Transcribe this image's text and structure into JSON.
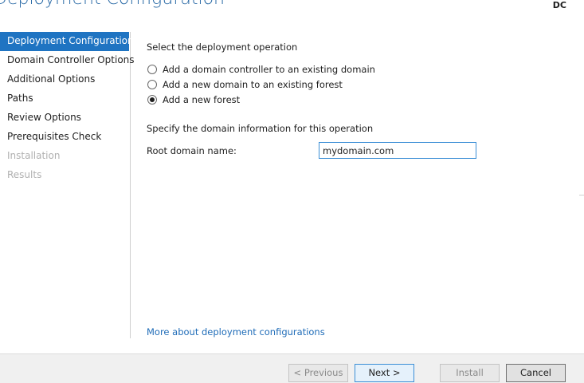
{
  "header": {
    "title": "Deployment Configuration",
    "server": "DC"
  },
  "sidebar": {
    "items": [
      {
        "label": "Deployment Configuration",
        "state": "active"
      },
      {
        "label": "Domain Controller Options",
        "state": "enabled"
      },
      {
        "label": "Additional Options",
        "state": "enabled"
      },
      {
        "label": "Paths",
        "state": "enabled"
      },
      {
        "label": "Review Options",
        "state": "enabled"
      },
      {
        "label": "Prerequisites Check",
        "state": "enabled"
      },
      {
        "label": "Installation",
        "state": "disabled"
      },
      {
        "label": "Results",
        "state": "disabled"
      }
    ]
  },
  "main": {
    "operation_heading": "Select the deployment operation",
    "options": [
      {
        "label": "Add a domain controller to an existing domain",
        "checked": false
      },
      {
        "label": "Add a new domain to an existing forest",
        "checked": false
      },
      {
        "label": "Add a new forest",
        "checked": true
      }
    ],
    "domain_heading": "Specify the domain information for this operation",
    "root_domain_label": "Root domain name:",
    "root_domain_value": "mydomain.com",
    "more_link": "More about deployment configurations"
  },
  "footer": {
    "previous_label": "< Previous",
    "next_label": "Next >",
    "install_label": "Install",
    "cancel_label": "Cancel"
  }
}
